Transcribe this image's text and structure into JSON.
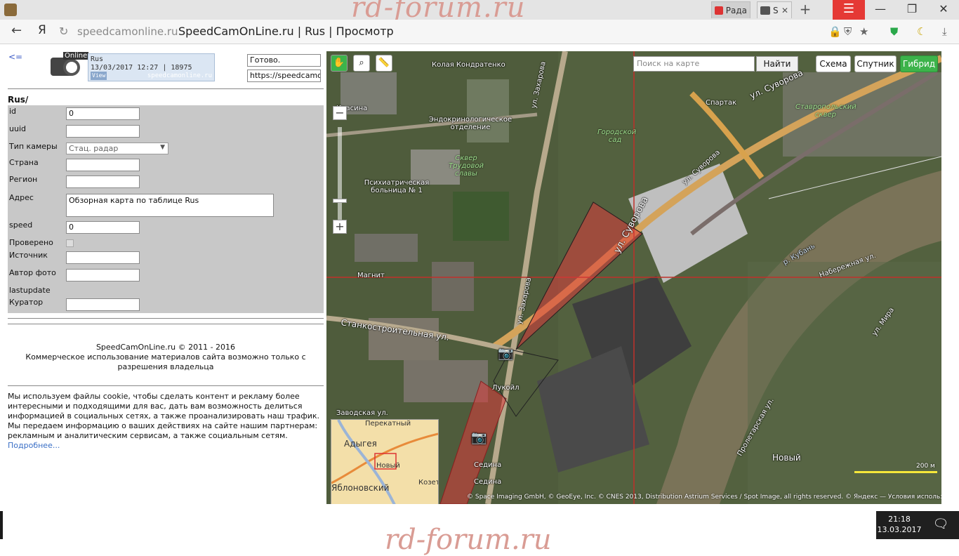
{
  "browser": {
    "watermark": "rd-forum.ru",
    "tabs": [
      {
        "label": "Рада",
        "color": "#d33"
      },
      {
        "label": "S",
        "color": "#555"
      }
    ],
    "tab_close": "✕",
    "new_tab_glyph": "+",
    "menu_glyph": "☰",
    "min_glyph": "—",
    "max_glyph": "❐",
    "close_glyph": "✕",
    "back_glyph": "←",
    "yandex_glyph": "Я",
    "reload_glyph": "↻",
    "url_host": "speedcamonline.ru",
    "url_title": "SpeedCamOnLine.ru | Rus | Просмотр"
  },
  "left": {
    "back_link": "<=",
    "logo_word": "Online",
    "info_box": {
      "line1": "Rus",
      "line2": "13/03/2017 12:27 | 18975",
      "view": "View",
      "site": "speedcamonline.ru"
    },
    "status": "Готово.",
    "status_url": "https://speedcamon",
    "section_title": "Rus/",
    "fields": {
      "id": {
        "label": "id",
        "value": "0"
      },
      "uuid": {
        "label": "uuid",
        "value": ""
      },
      "camera_type": {
        "label": "Тип камеры",
        "value": "Стац. радар"
      },
      "country": {
        "label": "Страна",
        "value": ""
      },
      "region": {
        "label": "Регион",
        "value": ""
      },
      "address": {
        "label": "Адрес",
        "value": "Обзорная карта по таблице Rus"
      },
      "speed": {
        "label": "speed",
        "value": "0"
      },
      "checked": {
        "label": "Проверено"
      },
      "source": {
        "label": "Источник",
        "value": ""
      },
      "photo_author": {
        "label": "Автор фото",
        "value": ""
      },
      "lastupdate": {
        "label": "lastupdate"
      },
      "curator": {
        "label": "Куратор",
        "value": ""
      }
    },
    "footer_line1": "SpeedCamOnLine.ru © 2011 - 2016",
    "footer_line2": "Коммерческое использование материалов сайта возможно только с разрешения владельца",
    "cookie_text": "Мы используем файлы cookie, чтобы сделать контент и рекламу более интересными и подходящими для вас, дать вам возможность делиться информацией в социальных сетях, а также проанализировать наш трафик. Мы передаем информацию о ваших действиях на сайте нашим партнерам: рекламным и аналитическим сервисам, а также социальным сетям.",
    "cookie_more": "Подробнее..."
  },
  "map": {
    "search_placeholder": "Поиск на карте",
    "find_button": "Найти",
    "layers": [
      "Схема",
      "Спутник",
      "Гибрид"
    ],
    "active_layer_color": "#3cb34a",
    "zoom_in": "+",
    "zoom_out": "−",
    "labels": {
      "street1": "Колая Кондратенко",
      "street2": "ул. Захарова",
      "street3": "ул. Суворова",
      "street4": "ул. Суворова",
      "street5": "ул. Суворова",
      "street6": "Станкостроительная ул.",
      "street7": "ул. Захарова",
      "street8": "Набережная ул.",
      "street9": "ул. Мира",
      "street10": "Пролетарская ул.",
      "hospital1": "Эндокринологическое отделение",
      "hospital2": "Психиатрическая больница № 1",
      "park1": "Сквер Трудовой славы",
      "park2": "Городской сад",
      "park3": "Ставропольский сквер",
      "spartak": "Спартак",
      "magnit": "Магнит",
      "lukoil": "Лукойл",
      "river": "р. Кубань",
      "novy": "Новый",
      "zavodskaya": "Заводская ул.",
      "sedina1": "Седина",
      "sedina2": "Седина",
      "krasina": "Красина"
    },
    "minimap": {
      "label1": "Перекатный",
      "label2": "Адыгея",
      "label3": "Новый",
      "label4": "Козет",
      "label5": "Яблоновский"
    },
    "copyright": "© Space Imaging GmbH, © GeoEye, Inc. © CNES 2013, Distribution Astrium Services / Spot Image, all rights reserved. © Яндекс — Условия использования",
    "scale_label": "200 м"
  },
  "taskbar": {
    "time": "21:18",
    "date": "13.03.2017",
    "notif_glyph": "🗨"
  }
}
